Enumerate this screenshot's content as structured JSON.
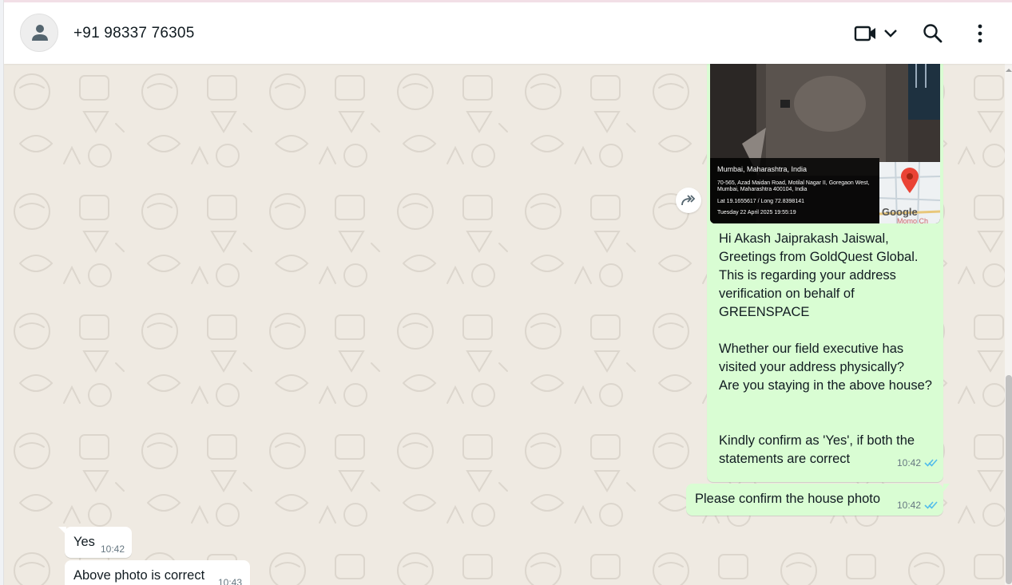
{
  "header": {
    "contact_name": "+91 98337 76305",
    "icons": [
      "person-icon",
      "video-camera-icon",
      "chevron-down-icon",
      "search-icon",
      "more-vertical-icon"
    ]
  },
  "colors": {
    "outgoing_bubble": "#d9fdd3",
    "incoming_bubble": "#ffffff",
    "wallpaper": "#efeae2",
    "read_ticks": "#53bdeb",
    "meta_text": "#667781"
  },
  "messages": [
    {
      "direction": "outgoing",
      "photo": {
        "city": "Mumbai, Maharashtra, India",
        "address": "70-565, Azad Maidan Road, Motilal Nagar II, Goregaon West, Mumbai, Maharashtra 400104, India",
        "latlong": "Lat 19.1655617 / Long 72.8398141",
        "datetime": "Tuesday 22 April 2025 19:55:19",
        "map_brand": "Google",
        "map_label": "Momo Ch"
      },
      "text": "Hi Akash Jaiprakash Jaiswal,\nGreetings from GoldQuest Global.\nThis is regarding your address verification on behalf of GREENSPACE\n\nWhether our field executive has visited your address physically?\nAre you staying in the above house?\n\n\nKindly confirm as 'Yes', if both the statements are correct",
      "time": "10:42",
      "status": "read"
    },
    {
      "direction": "outgoing",
      "text": "Please confirm the house photo",
      "time": "10:42",
      "status": "read"
    },
    {
      "direction": "incoming",
      "text": "Yes",
      "time": "10:42"
    },
    {
      "direction": "incoming",
      "text": "Above photo is correct",
      "time": "10:43"
    }
  ]
}
